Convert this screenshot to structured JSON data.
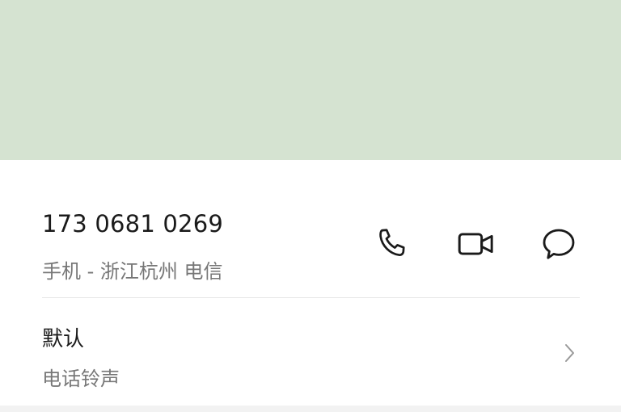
{
  "contact": {
    "phone_number": "173 0681 0269",
    "phone_meta": "手机 - 浙江杭州 电信"
  },
  "actions": {
    "call_icon": "phone-icon",
    "video_icon": "video-camera-icon",
    "message_icon": "chat-bubble-icon"
  },
  "ringtone": {
    "value": "默认",
    "label": "电话铃声"
  },
  "colors": {
    "banner": "#d5e3d1",
    "primary_text": "#1a1a1a",
    "secondary_text": "#777777",
    "icon": "#1a1a1a",
    "divider": "#e6e6e6"
  }
}
